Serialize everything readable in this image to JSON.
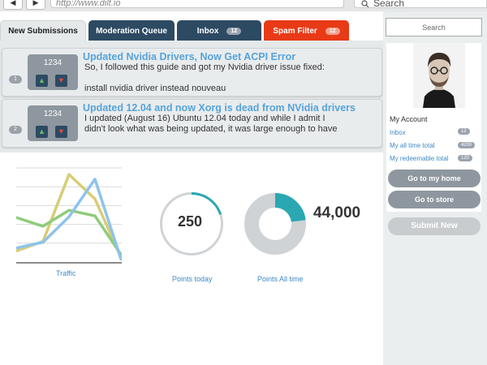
{
  "browser": {
    "back_glyph": "◀",
    "forward_glyph": "▶",
    "url": "http://www.dilt.io",
    "search_text": "Search"
  },
  "tabs": [
    {
      "label": "New Submissions",
      "badge": null
    },
    {
      "label": "Moderation Queue",
      "badge": null
    },
    {
      "label": "Inbox",
      "badge": "12"
    },
    {
      "label": "Spam Filter",
      "badge": "12"
    }
  ],
  "submissions": [
    {
      "rank": "1",
      "score": "1234",
      "title": "Updated Nvidia Drivers, Now Get ACPI Error",
      "body_line1": "So, I followed this guide and got my Nvidia driver issue fixed:",
      "body_line2": "install nvidia driver instead nouveau"
    },
    {
      "rank": "2",
      "score": "1234",
      "title": "Updated 12.04 and now Xorg is dead from NVidia drivers",
      "body_line1": "I updated (August 16) Ubuntu 12.04 today and while I admit I",
      "body_line2": "didn't look what was being updated, it was large enough to have"
    }
  ],
  "stats": {
    "traffic_label": "Traffic",
    "points_today_value": "250",
    "points_today_label": "Points today",
    "points_today_ring_fraction": 0.2,
    "points_all_value": "44,000",
    "points_all_label": "Points All time",
    "points_all_ring_fraction": 0.23
  },
  "chart_data": {
    "type": "line",
    "title": "",
    "xlabel": "Traffic",
    "ylabel": "",
    "x": [
      0,
      1,
      2,
      3,
      4
    ],
    "ylim": [
      0,
      10
    ],
    "grid": true,
    "series": [
      {
        "values": [
          1.2,
          2.2,
          9.3,
          6.7,
          0.5
        ],
        "color": "#d8cc76"
      },
      {
        "values": [
          4.7,
          3.8,
          5.5,
          4.9,
          0.8
        ],
        "color": "#8fcc7a"
      },
      {
        "values": [
          1.5,
          2.1,
          4.8,
          8.8,
          0.3
        ],
        "color": "#8ec3ec"
      }
    ]
  },
  "sidebar": {
    "search_placeholder": "Search",
    "account_title": "My Account",
    "links": [
      {
        "label": "Inbox",
        "badge": "12"
      },
      {
        "label": "My all time total",
        "badge": "4200"
      },
      {
        "label": "My redeemable total",
        "badge": "120"
      }
    ],
    "home_button": "Go to my home",
    "store_button": "Go to store",
    "submit_button": "Submit New"
  },
  "colors": {
    "accent_blue": "#56a3db",
    "tab_dark": "#2d4a63",
    "tab_red": "#e83a16",
    "ring_teal": "#2aa8b2"
  }
}
